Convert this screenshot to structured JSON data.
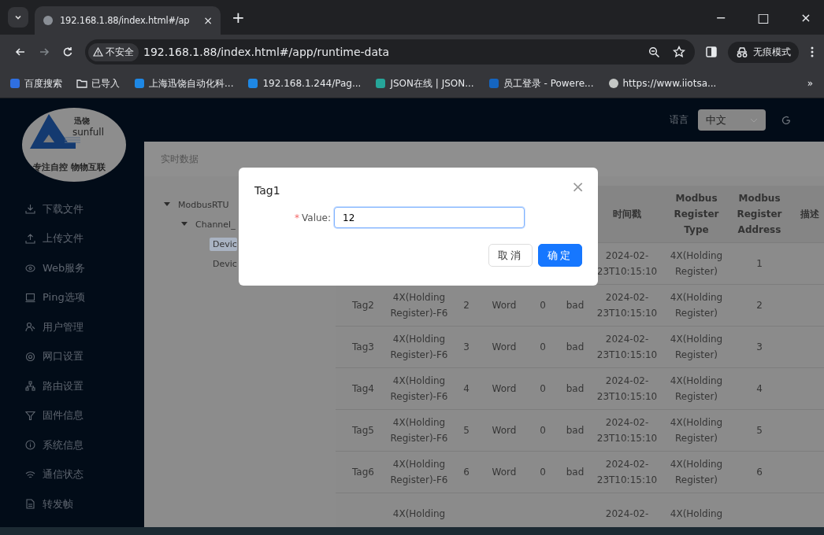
{
  "browser": {
    "tab": {
      "title": "192.168.1.88/index.html#/ap",
      "close": "×"
    },
    "new_tab": "+",
    "window_controls": [
      "−",
      "□",
      "×"
    ],
    "address": {
      "security": "不安全",
      "url": "192.168.1.88/index.html#/app/runtime-data"
    },
    "incognito": "无痕模式",
    "bookmarks": [
      "百度搜索",
      "已导入",
      "上海迅饶自动化科...",
      "192.168.1.244/Pag...",
      "JSON在线 | JSON...",
      "员工登录 - Powere...",
      "https://www.iiotsa..."
    ],
    "bookmarks_more": "»"
  },
  "logo": {
    "brand_cn": "迅饶",
    "brand": "sunfull",
    "slogan": "专注自控 物物互联"
  },
  "sidebar": {
    "items": [
      "下载文件",
      "上传文件",
      "Web服务",
      "Ping选项",
      "用户管理",
      "网口设置",
      "路由设置",
      "固件信息",
      "系统信息",
      "通信状态",
      "转发帧"
    ]
  },
  "header": {
    "language_label": "语言",
    "language": "中文"
  },
  "breadcrumb": "实时数据",
  "tree": [
    {
      "label": "ModbusRTU",
      "expanded": true,
      "children": [
        {
          "label": "Channel_",
          "expanded": true,
          "children": [
            {
              "label": "Devic",
              "selected": true
            },
            {
              "label": "Devic",
              "selected": false
            }
          ]
        }
      ]
    }
  ],
  "table": {
    "columns": [
      "时间戳",
      "Modbus Register Type",
      "Modbus Register Address",
      "描述"
    ],
    "rows": [
      {
        "timestamp": "2024-02-23T10:15:10",
        "register_type": "4X(Holding Register)",
        "register_address": "1"
      },
      {
        "name": "Tag2",
        "type": "4X(Holding Register)-F6",
        "column_3": "2",
        "column_4": "Word",
        "column_5": "0",
        "column_6": "bad",
        "timestamp": "2024-02-23T10:15:10",
        "register_type": "4X(Holding Register)",
        "register_address": "2"
      },
      {
        "name": "Tag3",
        "type": "4X(Holding Register)-F6",
        "column_3": "3",
        "column_4": "Word",
        "column_5": "0",
        "column_6": "bad",
        "timestamp": "2024-02-23T10:15:10",
        "register_type": "4X(Holding Register)",
        "register_address": "3"
      },
      {
        "name": "Tag4",
        "type": "4X(Holding Register)-F6",
        "column_3": "4",
        "column_4": "Word",
        "column_5": "0",
        "column_6": "bad",
        "timestamp": "2024-02-23T10:15:10",
        "register_type": "4X(Holding Register)",
        "register_address": "4"
      },
      {
        "name": "Tag5",
        "type": "4X(Holding Register)-F6",
        "column_3": "5",
        "column_4": "Word",
        "column_5": "0",
        "column_6": "bad",
        "timestamp": "2024-02-23T10:15:10",
        "register_type": "4X(Holding Register)",
        "register_address": "5"
      },
      {
        "name": "Tag6",
        "type": "4X(Holding Register)-F6",
        "column_3": "6",
        "column_4": "Word",
        "column_5": "0",
        "column_6": "bad",
        "timestamp": "2024-02-23T10:15:10",
        "register_type": "4X(Holding Register)",
        "register_address": "6"
      },
      {
        "type": "4X(Holding",
        "timestamp": "2024-02-",
        "register_type": "4X(Holding"
      }
    ]
  },
  "dialog": {
    "title": "Tag1",
    "close": "×",
    "field": {
      "required_mark": "*",
      "label": "Value:",
      "value": "12"
    },
    "buttons": [
      {
        "label": "取消",
        "kind": "default"
      },
      {
        "label": "确定",
        "kind": "primary"
      }
    ]
  }
}
